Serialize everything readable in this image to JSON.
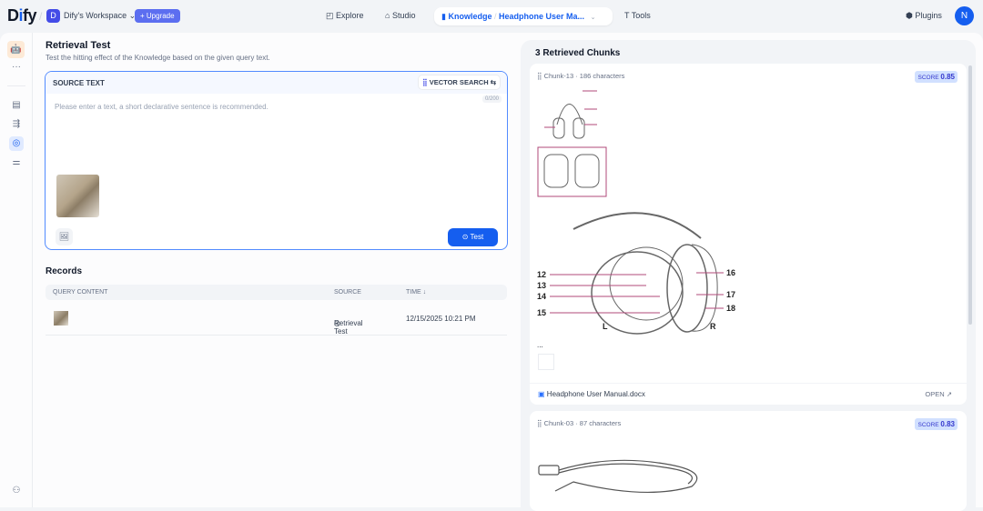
{
  "header": {
    "logo": "Dify",
    "workspace_initial": "D",
    "workspace": "Dify's Workspace",
    "upgrade": "+ Upgrade",
    "nav": {
      "explore": "Explore",
      "studio": "Studio",
      "knowledge": "Knowledge",
      "dataset": "Headphone User Ma...",
      "tools": "Tools",
      "plugins": "Plugins"
    },
    "avatar": "N"
  },
  "page": {
    "title": "Retrieval Test",
    "subtitle": "Test the hitting effect of the Knowledge based on the given query text."
  },
  "source": {
    "label": "SOURCE TEXT",
    "method": "VECTOR SEARCH",
    "count": "0/200",
    "placeholder": "Please enter a text, a short declarative sentence is recommended.",
    "test": "Test"
  },
  "records": {
    "title": "Records",
    "columns": [
      "QUERY CONTENT",
      "SOURCE",
      "TIME ↓"
    ],
    "rows": [
      {
        "source": "Retrieval Test",
        "time": "12/15/2025 10:21 PM"
      }
    ]
  },
  "results": {
    "title": "3 Retrieved Chunks",
    "chunks": [
      {
        "id": "Chunk-13",
        "chars": "186 characters",
        "score_label": "SCORE",
        "score": "0.85",
        "ellipsis": "...",
        "file": "Headphone User Manual.docx",
        "open": "OPEN",
        "labels": [
          "12",
          "13",
          "14",
          "15",
          "16",
          "17",
          "18",
          "L",
          "R"
        ]
      },
      {
        "id": "Chunk-03",
        "chars": "87 characters",
        "score_label": "SCORE",
        "score": "0.83"
      }
    ]
  }
}
